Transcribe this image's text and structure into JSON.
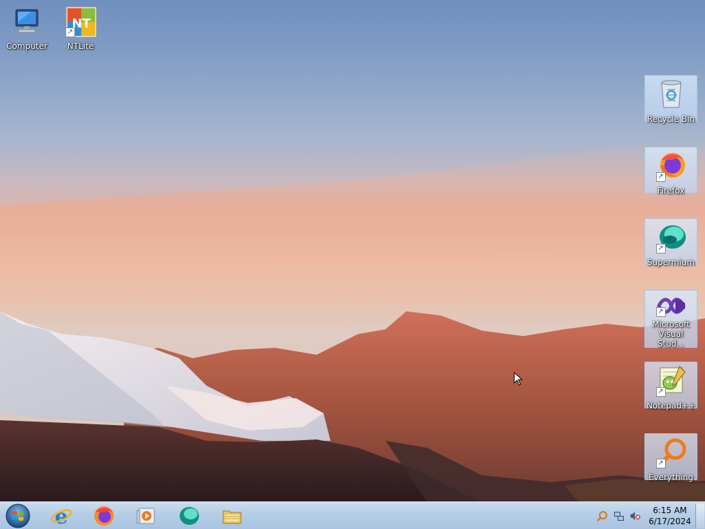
{
  "desktop": {
    "icons_left": [
      {
        "name": "computer-icon",
        "label": "Computer"
      },
      {
        "name": "ntlite-icon",
        "label": "NTLite"
      }
    ],
    "icons_right": [
      {
        "name": "recycle-bin-icon",
        "label": "Recycle Bin"
      },
      {
        "name": "firefox-icon",
        "label": "Firefox"
      },
      {
        "name": "supermium-icon",
        "label": "Supermium"
      },
      {
        "name": "visual-studio-icon",
        "label": "Microsoft Visual Stud..."
      },
      {
        "name": "notepad-plus-plus-icon",
        "label": "Notepad++"
      },
      {
        "name": "everything-search-icon",
        "label": "Everything"
      }
    ]
  },
  "taskbar": {
    "pinned": [
      "start-orb-icon",
      "internet-explorer-icon",
      "firefox-icon",
      "media-player-icon",
      "supermium-icon",
      "file-explorer-icon"
    ],
    "tray_icons": [
      "search-icon",
      "network-icon",
      "volume-muted-icon"
    ],
    "clock": {
      "time": "6:15 AM",
      "date": "6/17/2024"
    }
  },
  "colors": {
    "taskbar": "#b6cde6",
    "accent": "#1a4fa0"
  }
}
